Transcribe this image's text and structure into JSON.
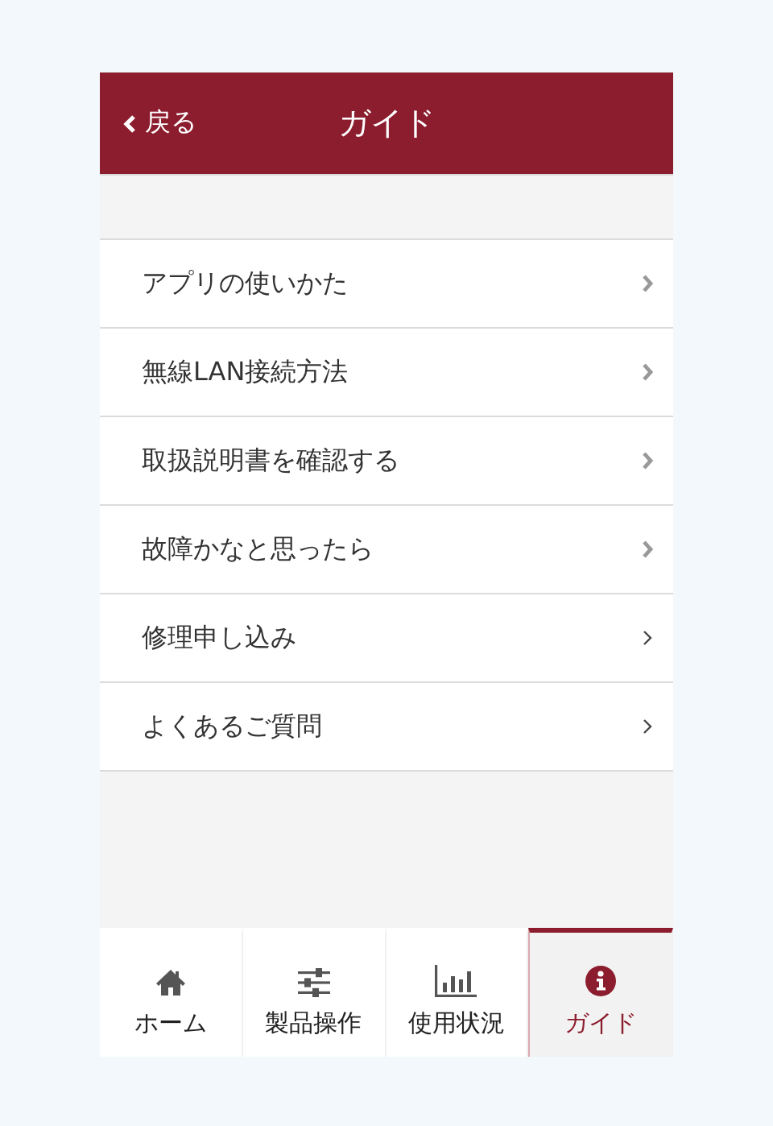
{
  "header": {
    "back": "戻る",
    "title": "ガイド"
  },
  "menu": [
    {
      "label": "アプリの使いかた",
      "kind": "bold"
    },
    {
      "label": "無線LAN接続方法",
      "kind": "bold"
    },
    {
      "label": "取扱説明書を確認する",
      "kind": "bold"
    },
    {
      "label": "故障かなと思ったら",
      "kind": "bold"
    },
    {
      "label": "修理申し込み",
      "kind": "thin"
    },
    {
      "label": "よくあるご質問",
      "kind": "thin"
    }
  ],
  "tabs": [
    {
      "label": "ホーム",
      "kind": "home",
      "selected": false
    },
    {
      "label": "製品操作",
      "kind": "sliders",
      "selected": false
    },
    {
      "label": "使用状況",
      "kind": "chart",
      "selected": false
    },
    {
      "label": "ガイド",
      "kind": "info",
      "selected": true
    }
  ]
}
